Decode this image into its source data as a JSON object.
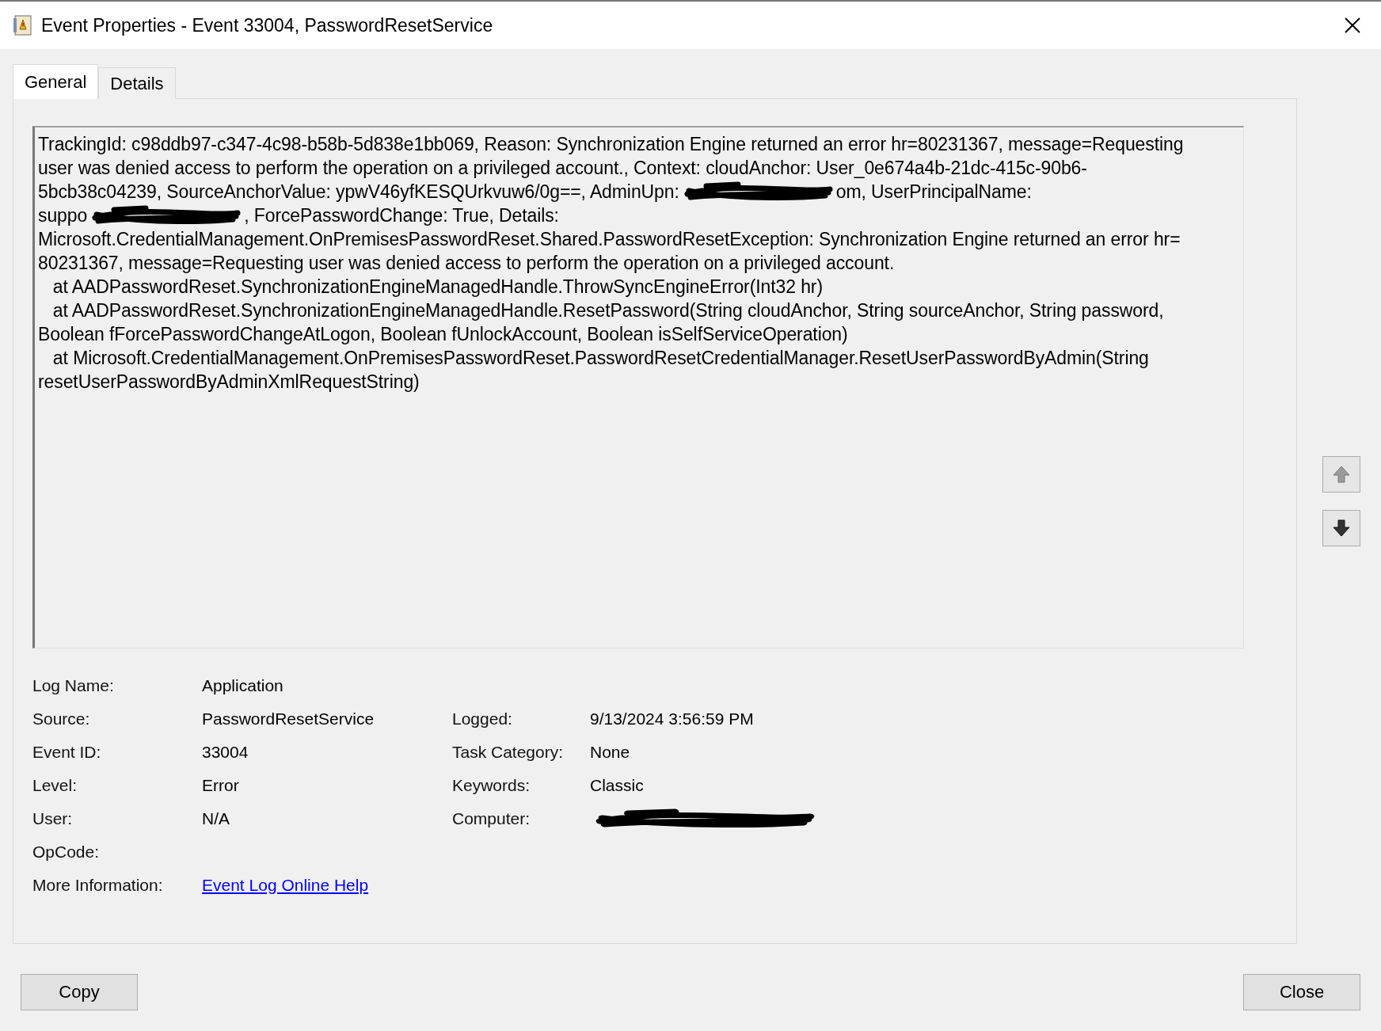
{
  "window": {
    "title": "Event Properties - Event 33004, PasswordResetService"
  },
  "tabs": [
    {
      "label": "General",
      "selected": true
    },
    {
      "label": "Details",
      "selected": false
    }
  ],
  "message": {
    "lines": [
      [
        {
          "kind": "text",
          "text": "TrackingId: c98ddb97-c347-4c98-b58b-5d838e1bb069, Reason: Synchronization Engine returned an error hr=80231367, message=Requesting"
        }
      ],
      [
        {
          "kind": "text",
          "text": "user was denied access to perform the operation on a privileged account., Context: cloudAnchor: User_0e674a4b-21dc-415c-90b6-"
        }
      ],
      [
        {
          "kind": "text",
          "text": "5bcb38c04239, SourceAnchorValue: ypwV46yfKESQUrkvuw6/0g==, AdminUpn:"
        },
        {
          "kind": "redaction"
        },
        {
          "kind": "text",
          "text": "om, UserPrincipalName:"
        }
      ],
      [
        {
          "kind": "text",
          "text": "suppo"
        },
        {
          "kind": "redaction"
        },
        {
          "kind": "text",
          "text": ", ForcePasswordChange: True, Details:"
        }
      ],
      [
        {
          "kind": "text",
          "text": "Microsoft.CredentialManagement.OnPremisesPasswordReset.Shared.PasswordResetException: Synchronization Engine returned an error hr="
        }
      ],
      [
        {
          "kind": "text",
          "text": "80231367, message=Requesting user was denied access to perform the operation on a privileged account."
        }
      ],
      [
        {
          "kind": "text",
          "text": "   at AADPasswordReset.SynchronizationEngineManagedHandle.ThrowSyncEngineError(Int32 hr)"
        }
      ],
      [
        {
          "kind": "text",
          "text": "   at AADPasswordReset.SynchronizationEngineManagedHandle.ResetPassword(String cloudAnchor, String sourceAnchor, String password,"
        }
      ],
      [
        {
          "kind": "text",
          "text": "Boolean fForcePasswordChangeAtLogon, Boolean fUnlockAccount, Boolean isSelfServiceOperation)"
        }
      ],
      [
        {
          "kind": "text",
          "text": "   at Microsoft.CredentialManagement.OnPremisesPasswordReset.PasswordResetCredentialManager.ResetUserPasswordByAdmin(String"
        }
      ],
      [
        {
          "kind": "text",
          "text": "resetUserPasswordByAdminXmlRequestString)"
        }
      ]
    ]
  },
  "fields_left": [
    {
      "label": "Log Name:",
      "kind": "text",
      "value": "Application"
    },
    {
      "label": "Source:",
      "kind": "text",
      "value": "PasswordResetService"
    },
    {
      "label": "Event ID:",
      "kind": "text",
      "value": "33004"
    },
    {
      "label": "Level:",
      "kind": "text",
      "value": "Error"
    },
    {
      "label": "User:",
      "kind": "text",
      "value": "N/A"
    },
    {
      "label": "OpCode:",
      "kind": "empty"
    },
    {
      "label": "More Information:",
      "kind": "link",
      "value": "Event Log Online Help"
    }
  ],
  "fields_right": [
    {
      "label": "Logged:",
      "kind": "text",
      "value": "9/13/2024 3:56:59 PM"
    },
    {
      "label": "Task Category:",
      "kind": "text",
      "value": "None"
    },
    {
      "label": "Keywords:",
      "kind": "text",
      "value": "Classic"
    },
    {
      "label": "Computer:",
      "kind": "redaction"
    }
  ],
  "buttons": [
    {
      "label": "Copy"
    },
    {
      "label": "Close"
    }
  ]
}
